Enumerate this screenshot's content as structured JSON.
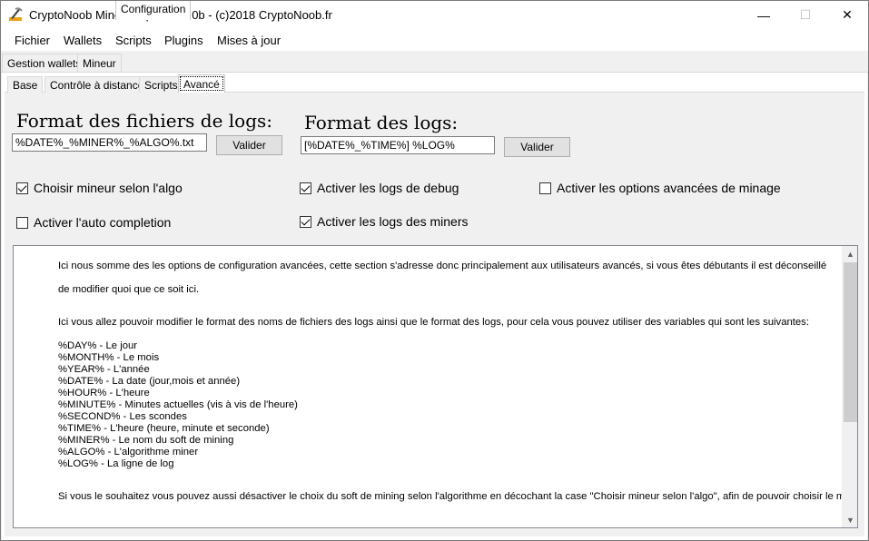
{
  "window": {
    "title": "CryptoNoob Miner Helper v3.7.0b - (c)2018 CryptoNoob.fr",
    "controls": {
      "minimize": "—",
      "maximize": "☐",
      "close": "✕"
    }
  },
  "menu": [
    "Fichier",
    "Wallets",
    "Scripts",
    "Plugins",
    "Mises à jour"
  ],
  "tabs": [
    "Gestion wallets",
    "Mineur",
    "Configuration"
  ],
  "subtabs": [
    "Base",
    "Contrôle à distance",
    "Scripts",
    "Avancé"
  ],
  "log_files": {
    "heading": "Format des fichiers de logs:",
    "value": "%DATE%_%MINER%_%ALGO%.txt",
    "button": "Valider"
  },
  "logs": {
    "heading": "Format des logs:",
    "value": "[%DATE%_%TIME%] %LOG%",
    "button": "Valider"
  },
  "options": {
    "choose_miner": {
      "label": "Choisir mineur selon l'algo",
      "checked": true
    },
    "auto_completion": {
      "label": "Activer l'auto completion",
      "checked": false
    },
    "debug_logs": {
      "label": "Activer les logs de debug",
      "checked": true
    },
    "miner_logs": {
      "label": "Activer les logs des miners",
      "checked": true
    },
    "advanced_mining": {
      "label": "Activer les options avancées de minage",
      "checked": false
    }
  },
  "help": {
    "intro_1": "Ici nous somme des les options de configuration avancées, cette section s'adresse donc principalement aux utilisateurs avancés, si vous êtes débutants il est déconseillé",
    "intro_2": "de modifier quoi que ce soit ici.",
    "vars_intro": "Ici vous allez pouvoir modifier le format des noms de fichiers des logs ainsi que le format des logs, pour cela vous pouvez utiliser des variables qui sont les suivantes:",
    "variables": [
      "%DAY% - Le jour",
      "%MONTH% - Le mois",
      "%YEAR% - L'année",
      "%DATE% - La date (jour,mois et année)",
      "%HOUR% - L'heure",
      "%MINUTE% - Minutes actuelles (vis à vis de l'heure)",
      "%SECOND% - Les scondes",
      "%TIME% - L'heure (heure, minute et seconde)",
      "%MINER% - Le nom du soft de mining",
      "%ALGO% - L'algorithme miner",
      "%LOG% - La ligne de log"
    ],
    "outro": "Si vous le souhaitez vous pouvez aussi désactiver le choix du soft de mining selon l'algorithme en décochant la case \"Choisir mineur selon l'algo\", afin de pouvoir choisir le mineur"
  },
  "colors": {
    "window_bg": "#f0f0f0",
    "button_bg": "#e1e1e1",
    "border": "#7a7a7a",
    "scroll_thumb": "#cdcdcd"
  }
}
